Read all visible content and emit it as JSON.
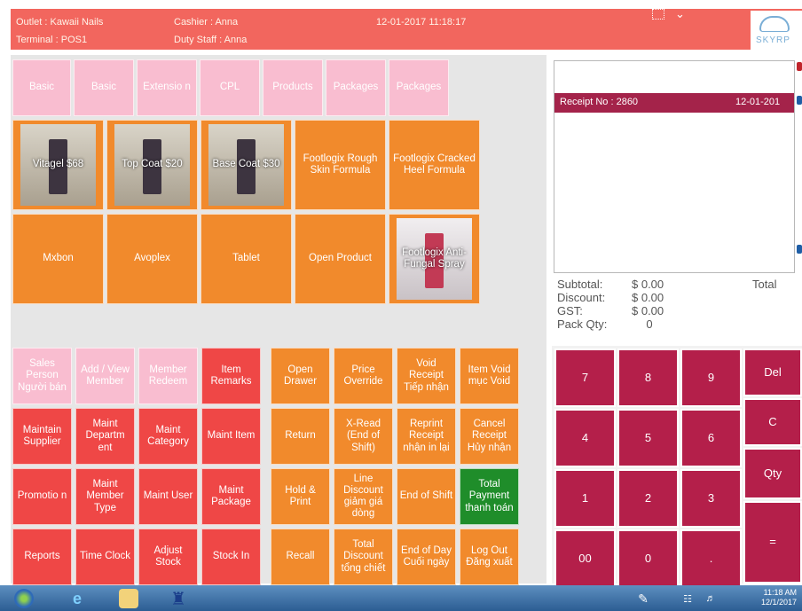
{
  "header": {
    "outlet": "Outlet : Kawaii Nails",
    "terminal": "Terminal : POS1",
    "cashier": "Cashier : Anna",
    "duty_staff": "Duty Staff : Anna",
    "datetime": "12-01-2017 11:18:17",
    "logo_text": "SKYRP"
  },
  "category_tabs": [
    {
      "label": "Basic"
    },
    {
      "label": "Basic"
    },
    {
      "label": "Extensio n"
    },
    {
      "label": "CPL"
    },
    {
      "label": "Products"
    },
    {
      "label": "Packages"
    },
    {
      "label": "Packages"
    }
  ],
  "products": [
    {
      "label": "Vitagel $68",
      "has_image": true
    },
    {
      "label": "Top Coat $20",
      "has_image": true
    },
    {
      "label": "Base Coat $30",
      "has_image": true
    },
    {
      "label": "Footlogix Rough Skin Formula",
      "has_image": false
    },
    {
      "label": "Footlogix Cracked Heel Formula",
      "has_image": false
    },
    {
      "label": "Mxbon",
      "has_image": false
    },
    {
      "label": "Avoplex",
      "has_image": false
    },
    {
      "label": "Tablet",
      "has_image": false
    },
    {
      "label": "Open Product",
      "has_image": false
    },
    {
      "label": "Footlogix Anti-Fungal Spray",
      "has_image": true
    }
  ],
  "function_buttons": [
    {
      "label": "Sales Person Người bán",
      "color": "pink"
    },
    {
      "label": "Add / View Member",
      "color": "pink"
    },
    {
      "label": "Member Redeem",
      "color": "pink"
    },
    {
      "label": "Item Remarks",
      "color": "red"
    },
    {
      "label": "Open Drawer",
      "color": "orange"
    },
    {
      "label": "Price Override",
      "color": "orange"
    },
    {
      "label": "Void Receipt Tiếp nhận",
      "color": "orange"
    },
    {
      "label": "Item Void mục Void",
      "color": "orange"
    },
    {
      "label": "Maintain Supplier",
      "color": "red"
    },
    {
      "label": "Maint Departm ent",
      "color": "red"
    },
    {
      "label": "Maint Category",
      "color": "red"
    },
    {
      "label": "Maint Item",
      "color": "red"
    },
    {
      "label": "Return",
      "color": "orange"
    },
    {
      "label": "X-Read (End of Shift)",
      "color": "orange"
    },
    {
      "label": "Reprint Receipt nhận in lại",
      "color": "orange"
    },
    {
      "label": "Cancel Receipt Hủy nhận",
      "color": "orange"
    },
    {
      "label": "Promotio n",
      "color": "red"
    },
    {
      "label": "Maint Member Type",
      "color": "red"
    },
    {
      "label": "Maint User",
      "color": "red"
    },
    {
      "label": "Maint Package",
      "color": "red"
    },
    {
      "label": "Hold & Print",
      "color": "orange"
    },
    {
      "label": "Line Discount giảm giá dòng",
      "color": "orange"
    },
    {
      "label": "End of Shift",
      "color": "orange"
    },
    {
      "label": "Total Payment thanh toán",
      "color": "green"
    },
    {
      "label": "Reports",
      "color": "red"
    },
    {
      "label": "Time Clock",
      "color": "red"
    },
    {
      "label": "Adjust Stock",
      "color": "red"
    },
    {
      "label": "Stock In",
      "color": "red"
    },
    {
      "label": "Recall",
      "color": "orange"
    },
    {
      "label": "Total Discount tổng chiết",
      "color": "orange"
    },
    {
      "label": "End of Day Cuối ngày",
      "color": "orange"
    },
    {
      "label": "Log Out Đăng xuất",
      "color": "orange"
    }
  ],
  "receipt": {
    "receipt_no": "Receipt No : 2860",
    "date": "12-01-201"
  },
  "totals": {
    "subtotal_label": "Subtotal:",
    "subtotal_value": "$ 0.00",
    "discount_label": "Discount:",
    "discount_value": "$ 0.00",
    "gst_label": "GST:",
    "gst_value": "$ 0.00",
    "packqty_label": "Pack Qty:",
    "packqty_value": "0",
    "total_label": "Total"
  },
  "keypad": [
    {
      "label": "7"
    },
    {
      "label": "8"
    },
    {
      "label": "9"
    },
    {
      "label": "4"
    },
    {
      "label": "5"
    },
    {
      "label": "6"
    },
    {
      "label": "1"
    },
    {
      "label": "2"
    },
    {
      "label": "3"
    },
    {
      "label": "00"
    },
    {
      "label": "0"
    },
    {
      "label": "."
    }
  ],
  "keypad_actions": [
    {
      "label": "Del"
    },
    {
      "label": "C"
    },
    {
      "label": "Qty"
    },
    {
      "label": "="
    }
  ],
  "taskbar": {
    "time": "11:18 AM",
    "date": "12/1/2017"
  },
  "colors": {
    "header_bg": "#f2665e",
    "pink": "#f9bdd0",
    "orange": "#f18a2c",
    "red": "#ef4746",
    "green": "#1f8d2a",
    "crimson": "#b41f4a"
  }
}
